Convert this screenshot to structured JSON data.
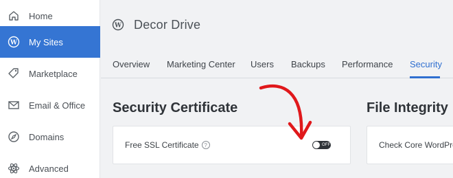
{
  "sidebar": {
    "items": [
      {
        "label": "Home",
        "icon": "home-icon",
        "active": false
      },
      {
        "label": "My Sites",
        "icon": "wordpress-icon",
        "active": true
      },
      {
        "label": "Marketplace",
        "icon": "tag-icon",
        "active": false
      },
      {
        "label": "Email & Office",
        "icon": "mail-icon",
        "active": false
      },
      {
        "label": "Domains",
        "icon": "compass-icon",
        "active": false
      },
      {
        "label": "Advanced",
        "icon": "atom-icon",
        "active": false
      }
    ]
  },
  "site": {
    "title": "Decor Drive",
    "icon": "wordpress-icon"
  },
  "tabs": [
    {
      "label": "Overview"
    },
    {
      "label": "Marketing Center"
    },
    {
      "label": "Users"
    },
    {
      "label": "Backups"
    },
    {
      "label": "Performance"
    },
    {
      "label": "Security",
      "active": true
    }
  ],
  "sections": {
    "security": {
      "title": "Security Certificate",
      "ssl_label": "Free SSL Certificate",
      "help_glyph": "?",
      "toggle_state": "OFF"
    },
    "integrity": {
      "title": "File Integrity",
      "check_label": "Check Core WordPress"
    }
  },
  "colors": {
    "accent": "#3575d3",
    "annotation_arrow": "#e0181b",
    "toggle_bg": "#2f3338"
  }
}
